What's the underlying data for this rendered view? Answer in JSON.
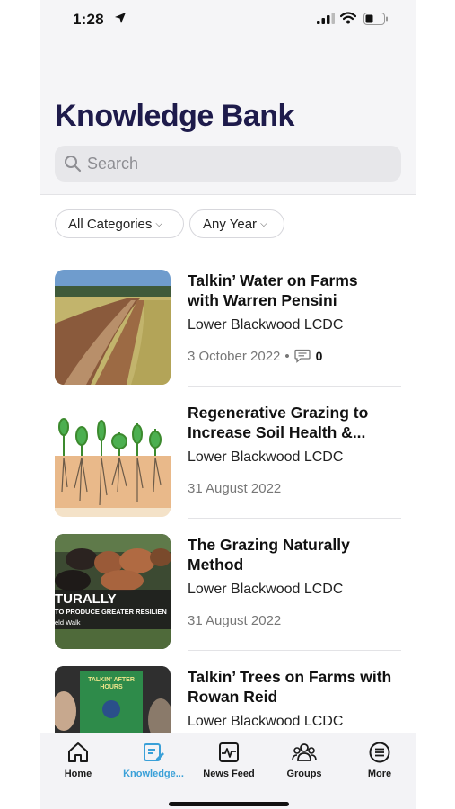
{
  "status_bar": {
    "time": "1:28",
    "icons": [
      "location-arrow-icon",
      "signal-icon",
      "wifi-icon",
      "battery-icon"
    ]
  },
  "header": {
    "title": "Knowledge Bank",
    "search_placeholder": "Search"
  },
  "filters": {
    "category": "All Categories",
    "year": "Any Year"
  },
  "items": [
    {
      "title": "Talkin’ Water on Farms with Warren Pensini",
      "org": "Lower Blackwood LCDC",
      "date": "3 October 2022",
      "comments": "0",
      "thumb": "drainage channel in field"
    },
    {
      "title": "Regenerative Grazing to Increase Soil Health &...",
      "org": "Lower Blackwood LCDC",
      "date": "31 August 2022",
      "thumb": "plant root diagram"
    },
    {
      "title": "The Grazing Naturally Method",
      "org": "Lower Blackwood LCDC",
      "date": "31 August 2022",
      "thumb": "cattle herd with banner",
      "thumb_text": [
        "TURALLY",
        "TO PRODUCE GREATER RESILIEN",
        "eld Walk"
      ]
    },
    {
      "title": "Talkin’ Trees on Farms with Rowan Reid",
      "org": "Lower Blackwood LCDC",
      "thumb": "video call poster",
      "thumb_text": [
        "TALKIN' AFTER",
        "HOURS"
      ]
    }
  ],
  "tabbar": {
    "tabs": [
      {
        "label": "Home",
        "icon": "home-icon"
      },
      {
        "label": "Knowledge...",
        "icon": "knowledge-icon",
        "active": true
      },
      {
        "label": "News Feed",
        "icon": "news-feed-icon"
      },
      {
        "label": "Groups",
        "icon": "groups-icon"
      },
      {
        "label": "More",
        "icon": "more-icon"
      }
    ]
  },
  "colors": {
    "title": "#1e1b4b",
    "active_tab": "#3aa0d8",
    "background": "#f5f5f7"
  }
}
